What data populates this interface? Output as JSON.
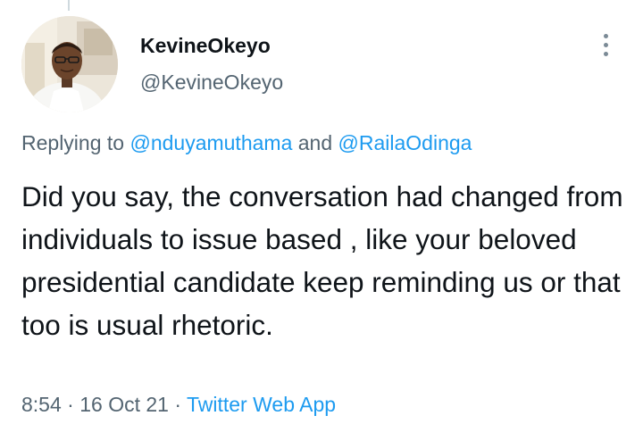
{
  "tweet": {
    "author": {
      "display_name": "KevineOkeyo",
      "handle": "@KevineOkeyo",
      "avatar_icon": "profile-photo"
    },
    "replying": {
      "prefix": "Replying to ",
      "mention_1": "@nduyamuthama",
      "conjunction": " and ",
      "mention_2": "@RailaOdinga"
    },
    "text": "Did you say, the conversation had changed from individuals to issue based , like your beloved presidential candidate keep reminding us or that too is usual rhetoric.",
    "meta": {
      "time": "8:54",
      "separator_1": " · ",
      "date": "16 Oct 21",
      "separator_2": " · ",
      "source": "Twitter Web App"
    },
    "more_icon": "more-vertical-icon"
  },
  "colors": {
    "text_primary": "#0f1419",
    "text_secondary": "#536471",
    "link": "#1d9bf0"
  }
}
